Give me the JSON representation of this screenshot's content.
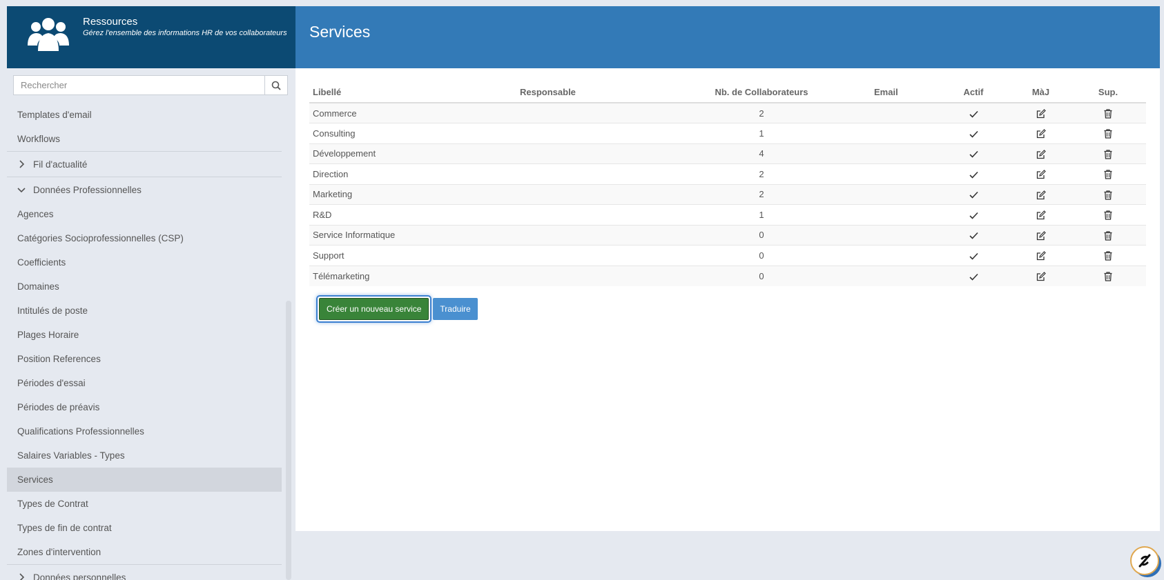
{
  "brand": {
    "title": "Ressources",
    "subtitle": "Gérez l'ensemble des informations HR de vos collaborateurs",
    "icon": "users-icon"
  },
  "search": {
    "placeholder": "Rechercher",
    "icon": "search-icon"
  },
  "menu": {
    "items_top": [
      "Templates d'email",
      "Workflows"
    ],
    "group_news": "Fil d'actualité",
    "group_pro": "Données Professionnelles",
    "items_pro": [
      "Agences",
      "Catégories Socioprofessionnelles (CSP)",
      "Coefficients",
      "Domaines",
      "Intitulés de poste",
      "Plages Horaire",
      "Position References",
      "Périodes d'essai",
      "Périodes de préavis",
      "Qualifications Professionnelles",
      "Salaires Variables - Types",
      "Services",
      "Types de Contrat",
      "Types de fin de contrat",
      "Zones d'intervention"
    ],
    "active_item": "Services",
    "group_personal": "Données personnelles"
  },
  "header": {
    "title": "Services"
  },
  "table": {
    "columns": [
      "Libellé",
      "Responsable",
      "Nb. de Collaborateurs",
      "Email",
      "Actif",
      "MàJ",
      "Sup."
    ],
    "rows": [
      {
        "label": "Commerce",
        "responsable": "",
        "count": "2",
        "email": ""
      },
      {
        "label": "Consulting",
        "responsable": "",
        "count": "1",
        "email": ""
      },
      {
        "label": "Développement",
        "responsable": "",
        "count": "4",
        "email": ""
      },
      {
        "label": "Direction",
        "responsable": "",
        "count": "2",
        "email": ""
      },
      {
        "label": "Marketing",
        "responsable": "",
        "count": "2",
        "email": ""
      },
      {
        "label": "R&D",
        "responsable": "",
        "count": "1",
        "email": ""
      },
      {
        "label": "Service Informatique",
        "responsable": "",
        "count": "0",
        "email": ""
      },
      {
        "label": "Support",
        "responsable": "",
        "count": "0",
        "email": ""
      },
      {
        "label": "Télémarketing",
        "responsable": "",
        "count": "0",
        "email": ""
      }
    ]
  },
  "buttons": {
    "create": "Créer un nouveau service",
    "translate": "Traduire"
  },
  "colors": {
    "brand": "#0c4a73",
    "header": "#337ab7",
    "create": "#398439",
    "translate": "#4a90d0"
  }
}
